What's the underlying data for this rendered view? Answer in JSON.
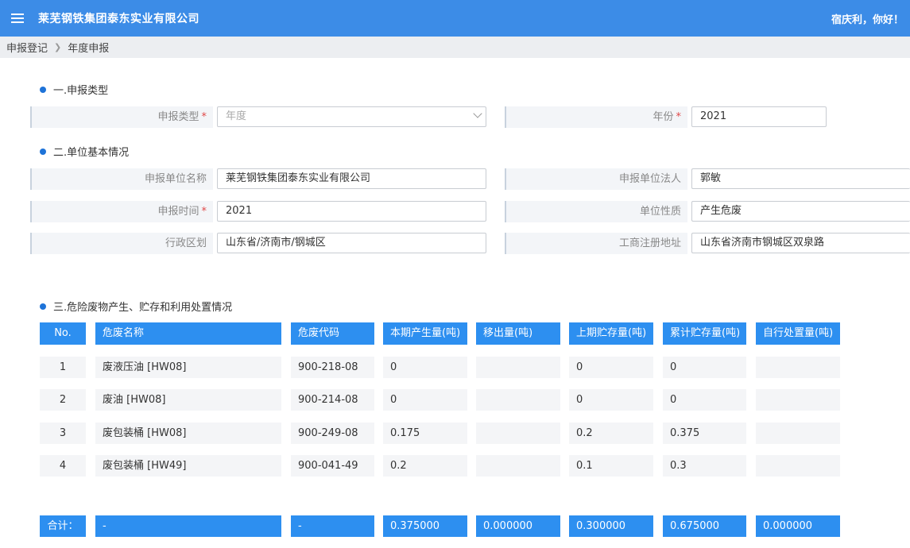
{
  "header": {
    "title": "莱芜钢铁集团泰东实业有限公司",
    "greeting": "宿庆利，你好！"
  },
  "breadcrumb": [
    "申报登记",
    "年度申报"
  ],
  "sections": {
    "s1": "一.申报类型",
    "s2": "二.单位基本情况",
    "s3": "三.危险废物产生、贮存和利用处置情况"
  },
  "form": {
    "report_type": {
      "label": "申报类型",
      "value": "年度"
    },
    "year": {
      "label": "年份",
      "value": "2021"
    },
    "unit_name": {
      "label": "申报单位名称",
      "value": "莱芜钢铁集团泰东实业有限公司"
    },
    "legal_person": {
      "label": "申报单位法人",
      "value": "郭敏"
    },
    "report_time": {
      "label": "申报时间",
      "value": "2021"
    },
    "unit_nature": {
      "label": "单位性质",
      "value": "产生危废"
    },
    "region": {
      "label": "行政区划",
      "value": "山东省/济南市/钢城区"
    },
    "reg_address": {
      "label": "工商注册地址",
      "value": "山东省济南市钢城区双泉路"
    },
    "required_mark": "*"
  },
  "table": {
    "headers": [
      "No.",
      "危废名称",
      "危废代码",
      "本期产生量(吨)",
      "移出量(吨)",
      "上期贮存量(吨)",
      "累计贮存量(吨)",
      "自行处置量(吨)"
    ],
    "rows": [
      [
        "1",
        "废液压油 [HW08]",
        "900-218-08",
        "0",
        "",
        "0",
        "0",
        ""
      ],
      [
        "2",
        "废油 [HW08]",
        "900-214-08",
        "0",
        "",
        "0",
        "0",
        ""
      ],
      [
        "3",
        "废包装桶 [HW08]",
        "900-249-08",
        "0.175",
        "",
        "0.2",
        "0.375",
        ""
      ],
      [
        "4",
        "废包装桶 [HW49]",
        "900-041-49",
        "0.2",
        "",
        "0.1",
        "0.3",
        ""
      ]
    ],
    "footer": [
      "合计：",
      "-",
      "-",
      "0.375000",
      "0.000000",
      "0.300000",
      "0.675000",
      "0.000000"
    ]
  },
  "colors": {
    "topbar": "#3c8ce7",
    "table_header": "#2d8ff0",
    "required": "#e04848"
  },
  "icons": {
    "menu": "menu-icon",
    "breadcrumb_separator": "chevron-right-icon",
    "select": "chevron-down-icon"
  }
}
